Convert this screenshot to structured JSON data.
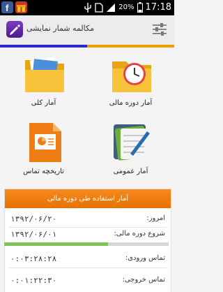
{
  "status_bar": {
    "time": "17:18",
    "battery_percent": "20%",
    "icons": [
      "facebook-icon",
      "gift-icon",
      "usb-icon",
      "sim-icon",
      "signal-icon",
      "battery-icon"
    ]
  },
  "app_bar": {
    "title": "مکالمه شمار نمایشی",
    "logo_icon": "phone-edit-logo-icon",
    "settings_icon": "sliders-icon"
  },
  "tiles": [
    {
      "label": "آمار دوره مالی",
      "icon": "folder-clock-icon"
    },
    {
      "label": "آمار کلی",
      "icon": "folder-icon"
    },
    {
      "label": "آمار عمومی",
      "icon": "notes-icon"
    },
    {
      "label": "تاریخچه تماس",
      "icon": "presentation-doc-icon"
    }
  ],
  "panel": {
    "title": "آمار استفاده طی دوره مالی",
    "rows": [
      {
        "label": "امروز:",
        "value": "۱۳۹۲/۰۶/۲۰"
      },
      {
        "label": "شروع دوره مالی:",
        "value": "۱۳۹۲/۰۶/۰۱"
      },
      {
        "label": "تماس ورودی:",
        "value": "۰:۰۳:۲۸:۲۸"
      },
      {
        "label": "تماس خروجی:",
        "value": "۰:۰۱:۲۲:۳۰"
      }
    ],
    "progress_fraction": 0.63
  },
  "colors": {
    "accent_blue": "#2a2ad0",
    "accent_orange": "#e8a000",
    "panel_header": "#f0810f",
    "progress": "#7fc55a"
  }
}
